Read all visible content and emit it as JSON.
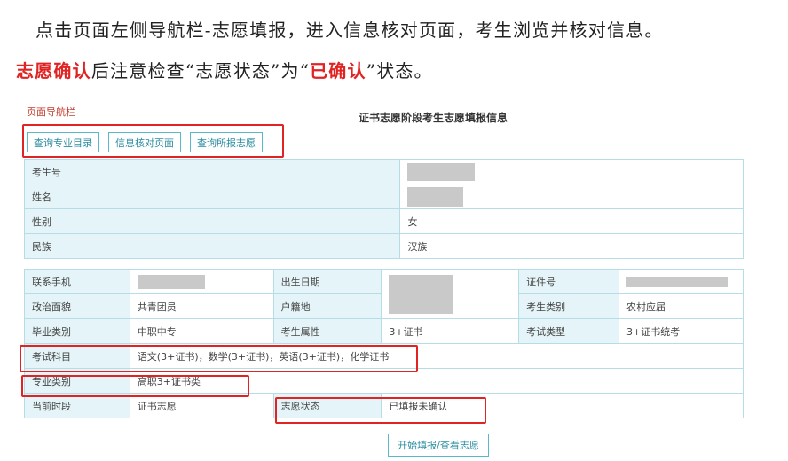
{
  "intro": {
    "line1": "点击页面左侧导航栏-志愿填报，进入信息核对页面，考生浏览并核对信息。",
    "line2_highlight": "志愿确认",
    "line2_text1": "后注意检查“志愿状态”为“",
    "line2_highlight2": "已确认",
    "line2_text2": "”状态。"
  },
  "nav": {
    "caption": "页面导航栏",
    "buttons": [
      "查询专业目录",
      "信息核对页面",
      "查询所报志愿"
    ]
  },
  "page_title": "证书志愿阶段考生志愿填报信息",
  "basic_info": [
    {
      "label": "考生号",
      "value": ""
    },
    {
      "label": "姓名",
      "value": ""
    },
    {
      "label": "性别",
      "value": "女"
    },
    {
      "label": "民族",
      "value": "汉族"
    }
  ],
  "detail": {
    "phone_label": "联系手机",
    "birth_label": "出生日期",
    "id_label": "证件号",
    "political_label": "政治面貌",
    "political_value": "共青团员",
    "hukou_label": "户籍地",
    "stu_type_label": "考生类别",
    "stu_type_value": "农村应届",
    "grad_label": "毕业类别",
    "grad_value": "中职中专",
    "attr_label": "考生属性",
    "attr_value": "3+证书",
    "exam_type_label": "考试类型",
    "exam_type_value": "3+证书统考",
    "subjects_label": "考试科目",
    "subjects_value": "语文(3+证书)，数学(3+证书)，英语(3+证书)，化学证书",
    "major_label": "专业类别",
    "major_value": "高职3+证书类",
    "stage_label": "当前时段",
    "stage_value": "证书志愿",
    "status_label": "志愿状态",
    "status_value": "已填报未确认"
  },
  "start_button": "开始填报/查看志愿",
  "colors": {
    "accent": "#e02424",
    "border": "#b6dde6",
    "label_bg": "#e5f4f8",
    "button": "#2a8ca0"
  }
}
